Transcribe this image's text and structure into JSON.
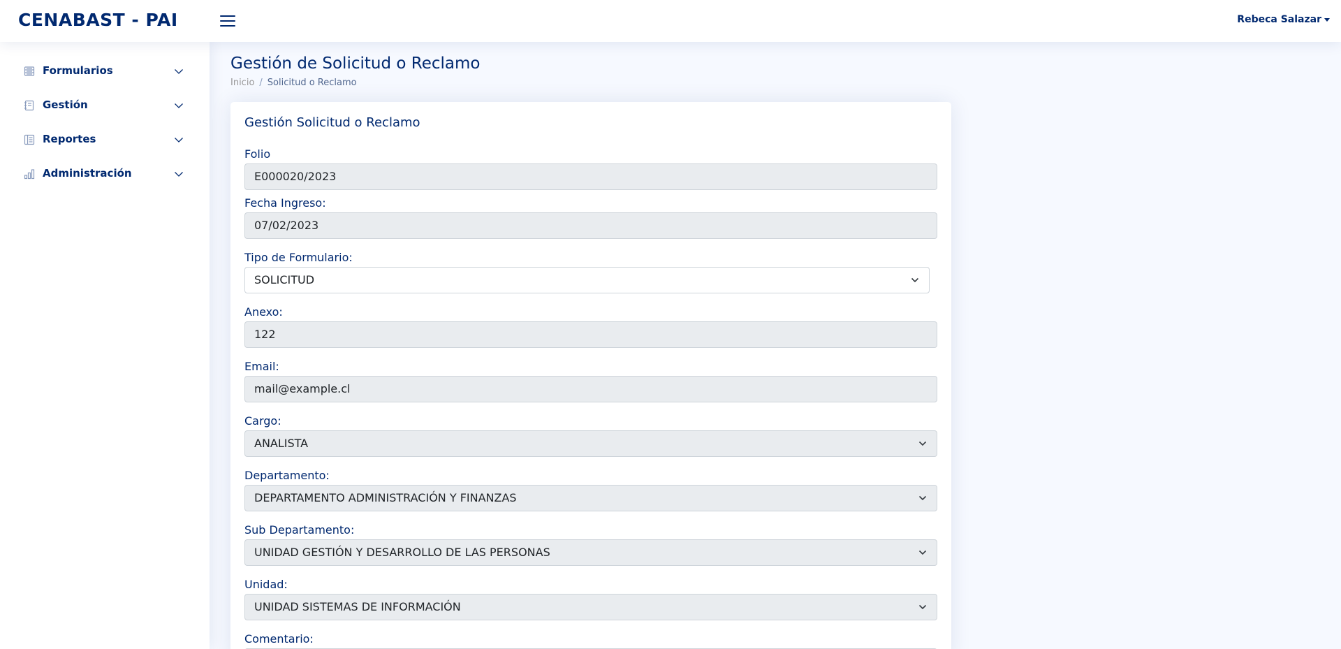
{
  "app": {
    "brand": "CENABAST - PAI",
    "user_name": "Rebeca Salazar"
  },
  "sidebar": {
    "items": [
      {
        "label": "Formularios",
        "icon": "form-list-icon"
      },
      {
        "label": "Gestión",
        "icon": "journal-icon"
      },
      {
        "label": "Reportes",
        "icon": "layout-text-icon"
      },
      {
        "label": "Administración",
        "icon": "bar-chart-icon"
      }
    ]
  },
  "page": {
    "title": "Gestión de Solicitud o Reclamo",
    "breadcrumb": [
      "Inicio",
      "Solicitud o Reclamo"
    ]
  },
  "form": {
    "card_title": "Gestión Solicitud o Reclamo",
    "folio": {
      "label": "Folio",
      "value": "E000020/2023"
    },
    "fecha_ingreso": {
      "label": "Fecha Ingreso:",
      "value": "07/02/2023"
    },
    "tipo_formulario": {
      "label": "Tipo de Formulario:",
      "value": "SOLICITUD"
    },
    "anexo": {
      "label": "Anexo:",
      "value": "122"
    },
    "email": {
      "label": "Email:",
      "value": "mail@example.cl"
    },
    "cargo": {
      "label": "Cargo:",
      "value": "ANALISTA"
    },
    "departamento": {
      "label": "Departamento:",
      "value": "DEPARTAMENTO ADMINISTRACIÓN Y FINANZAS"
    },
    "sub_departamento": {
      "label": "Sub Departamento:",
      "value": "UNIDAD GESTIÓN Y DESARROLLO DE LAS PERSONAS"
    },
    "unidad": {
      "label": "Unidad:",
      "value": "UNIDAD SISTEMAS DE INFORMACIÓN"
    },
    "comentario": {
      "label": "Comentario:"
    }
  },
  "colors": {
    "primary": "#012970",
    "background": "#f6f9ff",
    "disabled_field": "#e9ecef",
    "breadcrumb_muted": "#989797"
  }
}
